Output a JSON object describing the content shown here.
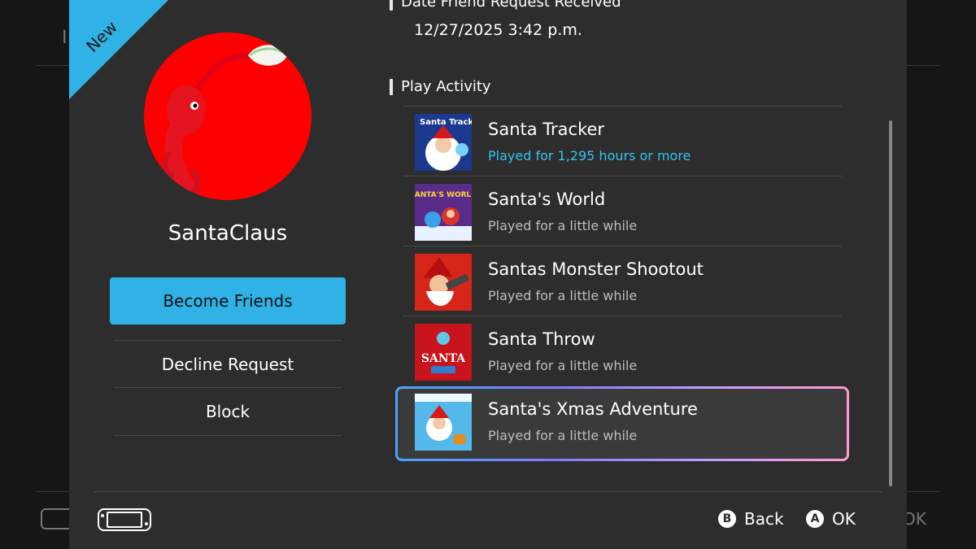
{
  "background": {
    "title_fragment": "I",
    "ok_label": "OK"
  },
  "ribbon": {
    "label": "New",
    "color": "#30b2e6"
  },
  "profile": {
    "username": "SantaClaus",
    "avatar_icon": "pikmin-icon",
    "avatar_color": "#ff0000"
  },
  "actions": {
    "become_friends": "Become Friends",
    "decline": "Decline Request",
    "block": "Block"
  },
  "request": {
    "heading": "Date Friend Request Received",
    "date": "12/27/2025 3:42 p.m."
  },
  "activity": {
    "heading": "Play Activity",
    "games": [
      {
        "title": "Santa Tracker",
        "played": "Played for 1,295 hours or more",
        "thumb_text": "Santa Tracker",
        "icon": "santa-tracker-thumb"
      },
      {
        "title": "Santa's World",
        "played": "Played for a little while",
        "thumb_text": "SANTA'S WORLD",
        "icon": "santas-world-thumb"
      },
      {
        "title": "Santas Monster Shootout",
        "played": "Played for a little while",
        "icon": "monster-shootout-thumb"
      },
      {
        "title": "Santa Throw",
        "played": "Played for a little while",
        "thumb_text": "SANTA",
        "icon": "santa-throw-thumb"
      },
      {
        "title": "Santa's Xmas Adventure",
        "played": "Played for a little while",
        "icon": "xmas-adventure-thumb"
      }
    ]
  },
  "footer": {
    "back_glyph": "B",
    "back_label": "Back",
    "ok_glyph": "A",
    "ok_label": "OK"
  }
}
